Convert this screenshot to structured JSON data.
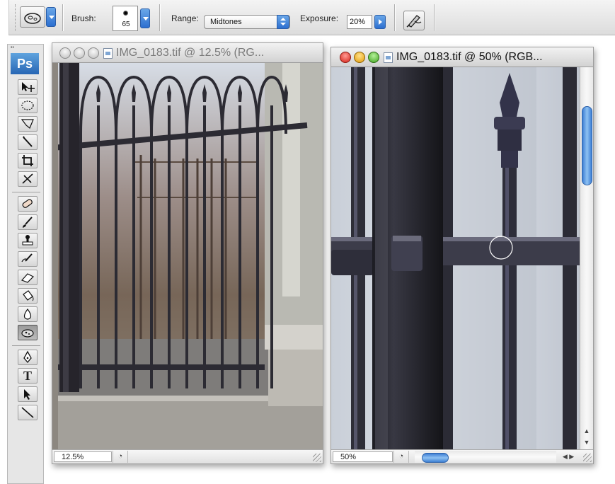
{
  "options_bar": {
    "tool_preset_icon": "sponge-tool-icon",
    "brush_label": "Brush:",
    "brush_size": "65",
    "range_label": "Range:",
    "range_value": "Midtones",
    "exposure_label": "Exposure:",
    "exposure_value": "20%",
    "airbrush_icon": "airbrush-icon"
  },
  "toolbox": {
    "logo": "Ps",
    "tools": [
      {
        "name": "move-tool-icon",
        "glyph": "▸✛"
      },
      {
        "name": "marquee-tool-icon",
        "glyph": "◯"
      },
      {
        "name": "lasso-tool-icon",
        "glyph": "ᐯ"
      },
      {
        "name": "magic-wand-tool-icon",
        "glyph": "⁄"
      },
      {
        "name": "crop-tool-icon",
        "glyph": "⌗"
      },
      {
        "name": "slice-tool-icon",
        "glyph": "✗"
      },
      {
        "name": "healing-brush-tool-icon",
        "glyph": "⌇"
      },
      {
        "name": "brush-tool-icon",
        "glyph": "∕"
      },
      {
        "name": "clone-stamp-tool-icon",
        "glyph": "♙"
      },
      {
        "name": "history-brush-tool-icon",
        "glyph": "↺"
      },
      {
        "name": "eraser-tool-icon",
        "glyph": "▱"
      },
      {
        "name": "paint-bucket-tool-icon",
        "glyph": "◊"
      },
      {
        "name": "blur-tool-icon",
        "glyph": "◇"
      },
      {
        "name": "sponge-tool-icon",
        "glyph": "◓"
      },
      {
        "name": "pen-tool-icon",
        "glyph": "✎"
      },
      {
        "name": "type-tool-icon",
        "glyph": "T"
      },
      {
        "name": "path-selection-tool-icon",
        "glyph": "➤"
      },
      {
        "name": "line-tool-icon",
        "glyph": "╲"
      }
    ]
  },
  "doc_left": {
    "title": "IMG_0183.tif @ 12.5% (RG...",
    "zoom": "12.5%",
    "active": false
  },
  "doc_right": {
    "title": "IMG_0183.tif @ 50% (RGB...",
    "zoom": "50%",
    "active": true
  },
  "colors": {
    "accent_blue": "#2c6fd0",
    "close_red": "#d51f14",
    "minimize_yellow": "#e29a08",
    "zoom_green": "#3fa51e"
  }
}
